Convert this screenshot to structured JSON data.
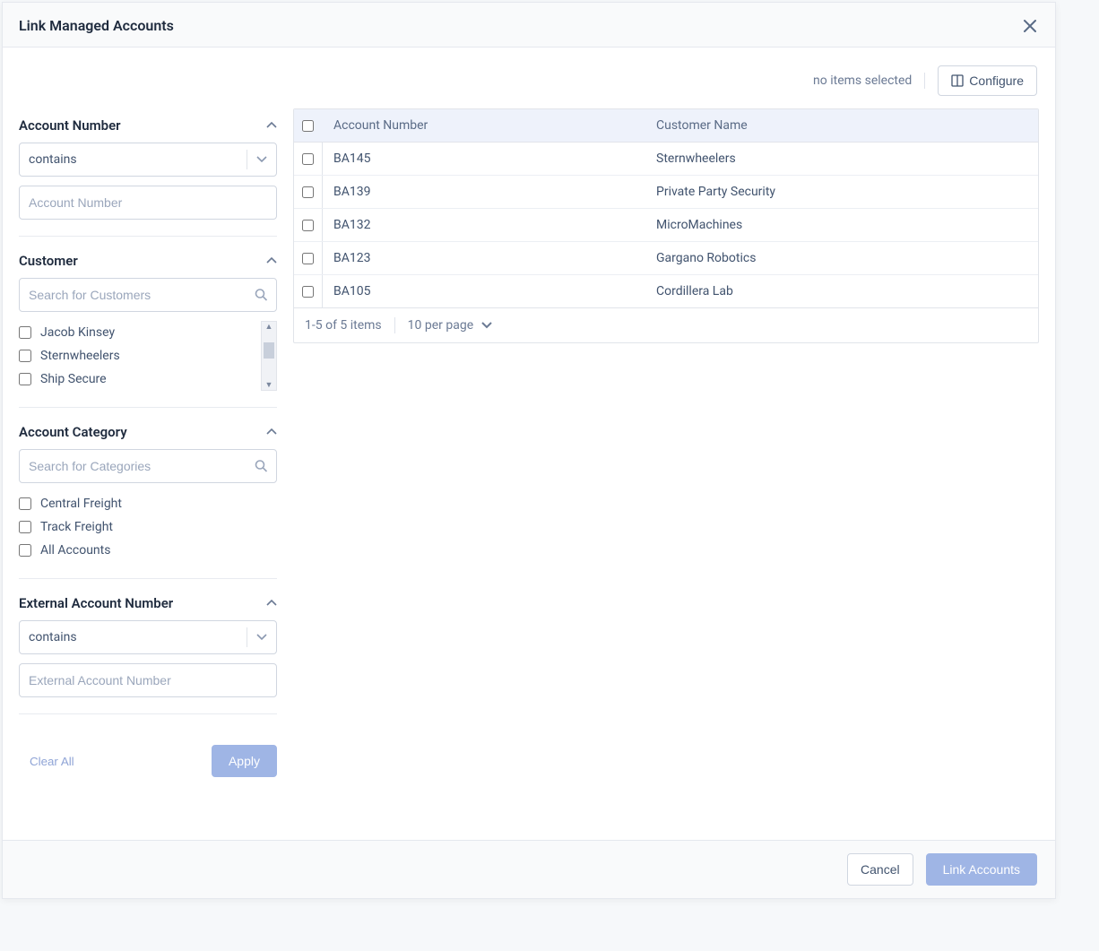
{
  "header": {
    "title": "Link Managed Accounts"
  },
  "toolbar": {
    "no_items": "no items selected",
    "configure": "Configure"
  },
  "filters": {
    "account_number": {
      "title": "Account Number",
      "operator": "contains",
      "placeholder": "Account Number"
    },
    "customer": {
      "title": "Customer",
      "search_placeholder": "Search for Customers",
      "options": [
        "Jacob Kinsey",
        "Sternwheelers",
        "Ship Secure"
      ]
    },
    "account_category": {
      "title": "Account Category",
      "search_placeholder": "Search for Categories",
      "options": [
        "Central Freight",
        "Track Freight",
        "All Accounts"
      ]
    },
    "external_account_number": {
      "title": "External Account Number",
      "operator": "contains",
      "placeholder": "External Account Number"
    },
    "clear_all": "Clear All",
    "apply": "Apply"
  },
  "table": {
    "columns": {
      "acct": "Account Number",
      "cust": "Customer Name"
    },
    "rows": [
      {
        "acct": "BA145",
        "cust": "Sternwheelers"
      },
      {
        "acct": "BA139",
        "cust": "Private Party Security"
      },
      {
        "acct": "BA132",
        "cust": "MicroMachines"
      },
      {
        "acct": "BA123",
        "cust": "Gargano Robotics"
      },
      {
        "acct": "BA105",
        "cust": "Cordillera Lab"
      }
    ],
    "footer": {
      "range": "1-5 of 5 items",
      "per_page": "10 per page"
    }
  },
  "footer": {
    "cancel": "Cancel",
    "link": "Link Accounts"
  }
}
